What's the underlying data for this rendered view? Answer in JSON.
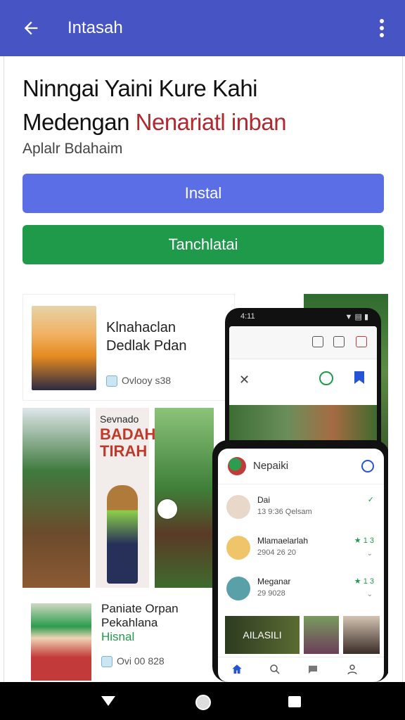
{
  "appbar": {
    "title": "Intasah",
    "back_icon": "back-arrow-icon",
    "menu_icon": "more-vert-icon",
    "color": "#4654c4"
  },
  "headline": {
    "line1": "Ninngai Yaini Kure Kahi",
    "line2_prefix": "Medengan ",
    "line2_accent": "Nenariatl inban",
    "accent_color": "#b1282e"
  },
  "subtitle": "Aplalr Bdahaim",
  "buttons": {
    "install": "Instal",
    "secondary": "Tanchlatai",
    "install_color": "#5b6ee6",
    "secondary_color": "#1f9a4a"
  },
  "preview": {
    "card1": {
      "title_line1": "Klnahaclan",
      "title_line2": "Dedlak Pdan",
      "meta": "Ovlooy s38"
    },
    "poster": {
      "top": "Sevnado",
      "main": "BADAH TIRAH"
    },
    "card2": {
      "line1": "Paniate Orpan",
      "line2": "Pekahlana",
      "line3": "Hisnal",
      "meta": "Ovi 00 828"
    }
  },
  "phone1": {
    "statusbar_left": "4:11",
    "statusbar_right": "▼ ▤ ▮"
  },
  "phone2": {
    "header_name": "Nepaiki",
    "items": [
      {
        "name": "Dai",
        "sub": "13 9:36 Qelsam"
      },
      {
        "name": "Mlamaelarlah",
        "sub": "2904 26 20"
      },
      {
        "name": "Meganar",
        "sub": "29 9028"
      }
    ],
    "badges": [
      "✓",
      "★ 1 3",
      "★ 1 3"
    ],
    "thumb_label": "AILASILI"
  },
  "navbar": {
    "back_icon": "nav-back-icon",
    "home_icon": "nav-home-icon",
    "recents_icon": "nav-recents-icon"
  }
}
